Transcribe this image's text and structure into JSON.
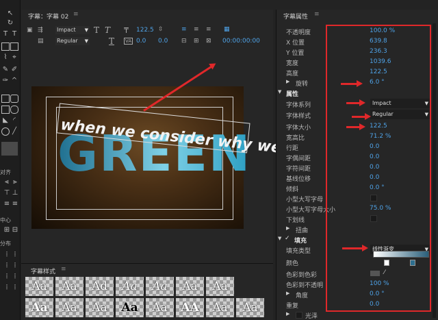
{
  "center": {
    "tab_label": "字幕：字幕 02",
    "menu_glyph": "≡"
  },
  "toolbar": {
    "font_family": "Impact",
    "font_style": "Regular",
    "font_size": "122.5",
    "tracking": "0.0",
    "kerning": "0.0",
    "timecode": "00:00:00:00"
  },
  "canvas": {
    "title_text": "GREEN",
    "sub_text": "when we consider why we"
  },
  "styles": {
    "title": "字幕样式",
    "menu_glyph": "≡",
    "swatches": [
      "Aa",
      "Aa",
      "Ad",
      "Aa",
      "Aa",
      "Aa",
      "Aa",
      "Aa",
      "Aa",
      "Aa",
      "Aa",
      "Aa",
      "AA",
      "Aa",
      "Aa"
    ]
  },
  "props": {
    "title": "字幕属性",
    "menu_glyph": "≡",
    "rows": [
      {
        "label": "不透明度",
        "value": "100.0 %"
      },
      {
        "label": "X 位置",
        "value": "639.8"
      },
      {
        "label": "Y 位置",
        "value": "236.3"
      },
      {
        "label": "宽度",
        "value": "1039.6"
      },
      {
        "label": "高度",
        "value": "122.5"
      },
      {
        "label": "旋转",
        "value": "6.0 °"
      }
    ],
    "section_props": "属性",
    "font_family_label": "字体系列",
    "font_family_value": "Impact",
    "font_style_label": "字体样式",
    "font_style_value": "Regular",
    "rows2": [
      {
        "label": "字体大小",
        "value": "122.5"
      },
      {
        "label": "宽高比",
        "value": "71.2 %"
      },
      {
        "label": "行距",
        "value": "0.0"
      },
      {
        "label": "字偶间距",
        "value": "0.0"
      },
      {
        "label": "字符间距",
        "value": "0.0"
      },
      {
        "label": "基线位移",
        "value": "0.0"
      },
      {
        "label": "倾斜",
        "value": "0.0 °"
      }
    ],
    "small_caps_label": "小型大写字母",
    "small_caps_size_label": "小型大写字母大小",
    "small_caps_size_value": "75.0 %",
    "underline_label": "下划线",
    "distort_label": "扭曲",
    "section_fill": "填充",
    "fill_type_label": "填充类型",
    "fill_type_value": "线性渐变",
    "color_label": "颜色",
    "color_to_color_label": "色彩到色彩",
    "color_to_opacity_label": "色彩到不透明",
    "color_to_opacity_value": "100 %",
    "angle_label": "角度",
    "angle_value": "0.0 °",
    "repeat_label": "重复",
    "repeat_value": "0.0",
    "sheen_label": "光泽"
  },
  "left_labels": {
    "a": "对齐",
    "b": "中心",
    "c": "分布"
  },
  "colors": {
    "accent": "#4fa3e8",
    "annotation": "#e0282a"
  }
}
